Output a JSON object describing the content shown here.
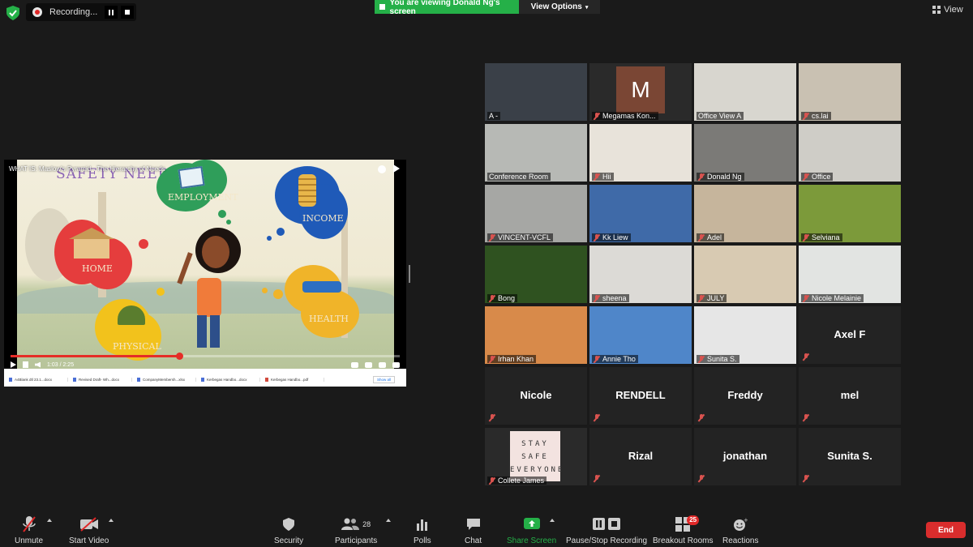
{
  "topbar": {
    "recording_label": "Recording...",
    "viewing_banner": "You are viewing Donald Ng's screen",
    "view_options_label": "View Options",
    "view_label": "View"
  },
  "shared_screen": {
    "video_title": "WHAT IS: Maslow's Pyramid - The Hierarchy of Needs",
    "time": "1:03 / 2:25",
    "progress": 0.434,
    "scene_labels": {
      "safety": "SAFETY NEEDS",
      "employment": "EMPLOYMENT",
      "income": "INCOME",
      "home": "HOME",
      "health": "HEALTH",
      "physical": "PHYSICAL"
    },
    "downloads": [
      {
        "name": "A4Blank dtl 23.1...docx",
        "type": "doc"
      },
      {
        "name": "Revised Draft- Wh...docx",
        "type": "doc"
      },
      {
        "name": "CompanyMembersh...xlsx",
        "type": "doc"
      },
      {
        "name": "Kerbegas Handbo...docx",
        "type": "doc"
      },
      {
        "name": "Kerbegas Handbo...pdf",
        "type": "pdf"
      }
    ],
    "show_all": "Show all"
  },
  "participants": [
    {
      "name": "A -",
      "muted": false,
      "video": true,
      "bg": "#3a4048"
    },
    {
      "name": "Megamas Kon...",
      "muted": true,
      "video": true,
      "initial": "M",
      "bg": "#2a2a2a"
    },
    {
      "name": "Office View A",
      "muted": false,
      "video": true,
      "bg": "#d8d6cf"
    },
    {
      "name": "cs.lai",
      "muted": true,
      "video": true,
      "bg": "#c9c1b2"
    },
    {
      "name": "Conference Room",
      "muted": false,
      "video": true,
      "bg": "#b7b9b5"
    },
    {
      "name": "Hii",
      "muted": true,
      "video": true,
      "bg": "#e8e3da"
    },
    {
      "name": "Donald Ng",
      "muted": true,
      "video": true,
      "bg": "#7b7a77",
      "speaker": true
    },
    {
      "name": "Office",
      "muted": true,
      "video": true,
      "bg": "#cfcdc7"
    },
    {
      "name": "VINCENT-VCFL",
      "muted": true,
      "video": true,
      "bg": "#a6a7a4"
    },
    {
      "name": "Kk Liew",
      "muted": true,
      "video": true,
      "bg": "#3f6aa8"
    },
    {
      "name": "Adel",
      "muted": true,
      "video": true,
      "bg": "#c6b59c"
    },
    {
      "name": "Selviana",
      "muted": true,
      "video": true,
      "bg": "#7c9a3a"
    },
    {
      "name": "Bong",
      "muted": true,
      "video": true,
      "bg": "#2f5220"
    },
    {
      "name": "sheena",
      "muted": true,
      "video": true,
      "bg": "#dcdad6"
    },
    {
      "name": "JULY",
      "muted": true,
      "video": true,
      "bg": "#d8cab2"
    },
    {
      "name": "Nicole Melainie",
      "muted": true,
      "video": true,
      "bg": "#e2e4e2"
    },
    {
      "name": "Irhan Khan",
      "muted": true,
      "video": true,
      "bg": "#d88a4a"
    },
    {
      "name": "Annie Tho",
      "muted": true,
      "video": true,
      "bg": "#4f86c9"
    },
    {
      "name": "Sunita S.",
      "muted": true,
      "video": true,
      "bg": "#e6e6e6"
    },
    {
      "name": "Axel F",
      "muted": true,
      "video": false
    },
    {
      "name": "Nicole",
      "muted": true,
      "video": false
    },
    {
      "name": "RENDELL",
      "muted": true,
      "video": false
    },
    {
      "name": "Freddy",
      "muted": true,
      "video": false
    },
    {
      "name": "mel",
      "muted": true,
      "video": false
    },
    {
      "name": "Collete James",
      "muted": true,
      "video": true,
      "bg": "#2a2a2a",
      "poster": "STAY SAFE EVERYONE"
    },
    {
      "name": "Rizal",
      "muted": true,
      "video": false
    },
    {
      "name": "jonathan",
      "muted": true,
      "video": false
    },
    {
      "name": "Sunita S.",
      "muted": true,
      "video": false
    }
  ],
  "toolbar": {
    "unmute": "Unmute",
    "start_video": "Start Video",
    "security": "Security",
    "participants": "Participants",
    "participants_count": "28",
    "polls": "Polls",
    "chat": "Chat",
    "share_screen": "Share Screen",
    "pause_stop_recording": "Pause/Stop Recording",
    "breakout_rooms": "Breakout Rooms",
    "breakout_badge": "25",
    "reactions": "Reactions",
    "end": "End"
  },
  "colors": {
    "banner_green": "#25b048",
    "end_red": "#d92d2d",
    "mute_red": "#d9534f",
    "speaker_highlight": "#b8e35a"
  }
}
